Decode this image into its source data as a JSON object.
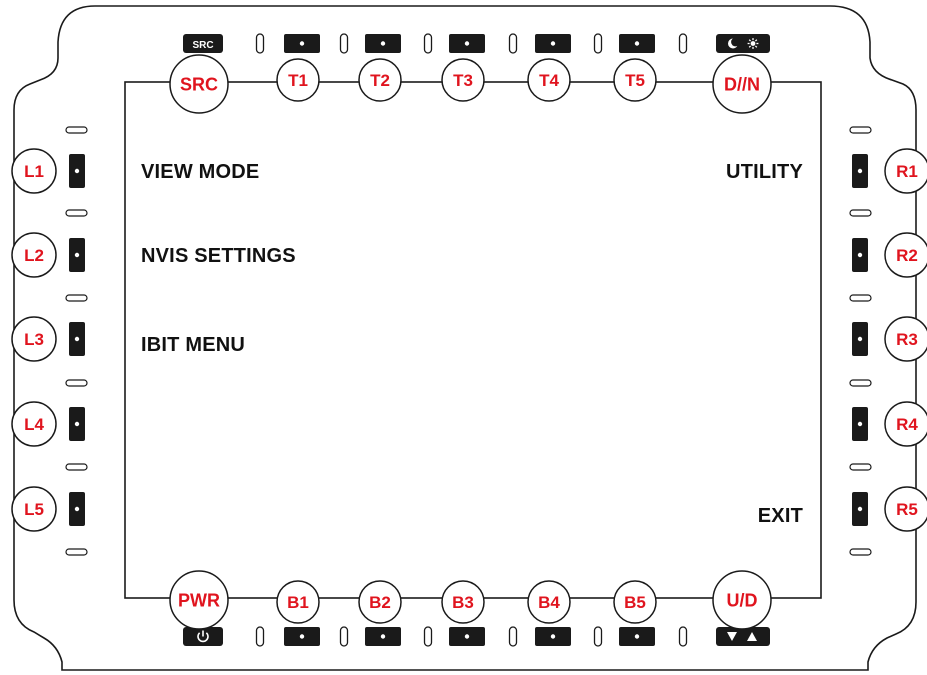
{
  "device": {
    "frame_color": "#1a1a1a",
    "label_color": "#e0141e",
    "key_color": "#1a1a1a"
  },
  "top_bezel": {
    "src_badge": "SRC",
    "day_night_badge_icons": [
      "moon-icon",
      "sun-icon"
    ],
    "buttons": [
      "SRC",
      "T1",
      "T2",
      "T3",
      "T4",
      "T5",
      "D//N"
    ]
  },
  "bottom_bezel": {
    "power_badge_icon": "power-icon",
    "up_down_badge_icons": [
      "triangle-down-icon",
      "triangle-up-icon"
    ],
    "buttons": [
      "PWR",
      "B1",
      "B2",
      "B3",
      "B4",
      "B5",
      "U/D"
    ]
  },
  "left_bezel": {
    "buttons": [
      "L1",
      "L2",
      "L3",
      "L4",
      "L5"
    ]
  },
  "right_bezel": {
    "buttons": [
      "R1",
      "R2",
      "R3",
      "R4",
      "R5"
    ]
  },
  "screen": {
    "left_menu": [
      "VIEW MODE",
      "NVIS SETTINGS",
      "IBIT MENU"
    ],
    "right_menu": {
      "r1": "UTILITY",
      "r5": "EXIT"
    }
  }
}
